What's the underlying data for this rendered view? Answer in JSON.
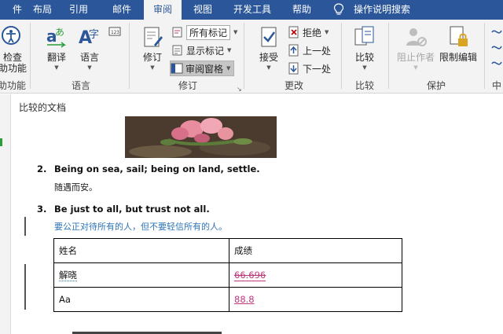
{
  "tabs": [
    {
      "label": "布局",
      "active": false
    },
    {
      "label": "引用",
      "active": false
    },
    {
      "label": "邮件",
      "active": false
    },
    {
      "label": "审阅",
      "active": true
    },
    {
      "label": "视图",
      "active": false
    },
    {
      "label": "开发工具",
      "active": false
    },
    {
      "label": "帮助",
      "active": false
    }
  ],
  "tell_me": "操作说明搜索",
  "ribbon": {
    "check_accessibility": {
      "line1": "检查",
      "line2": "助功能"
    },
    "group_accessibility": "助功能",
    "translate": "翻译",
    "language": "语言",
    "group_language": "语言",
    "track_changes": "修订",
    "markup_select": "所有标记",
    "show_markup": "显示标记",
    "reviewing_pane": "审阅窗格",
    "group_tracking": "修订",
    "accept": "接受",
    "reject": "拒绝",
    "previous": "上一处",
    "next": "下一处",
    "group_changes": "更改",
    "compare": "比较",
    "group_compare": "比较",
    "block_authors": "阻止作者",
    "restrict_editing": "限制编辑",
    "group_protect": "保护",
    "group_ink_partial": "中"
  },
  "document": {
    "title": "比较的文档",
    "items": [
      {
        "number": "2.",
        "en": "Being on sea, sail; being on land, settle.",
        "zh": "随遇而安。"
      },
      {
        "number": "3.",
        "en": "Be just to all, but trust not all.",
        "zh": "要公正对待所有的人，但不要轻信所有的人。"
      }
    ],
    "table": {
      "headers": [
        "姓名",
        "成绩"
      ],
      "rows": [
        {
          "name": "解晓",
          "score": "66.696"
        },
        {
          "name": "Aa",
          "score": "88.8"
        }
      ]
    }
  },
  "colors": {
    "brand": "#2b579a",
    "revision": "#c0397b",
    "insert_blue": "#2e75b6"
  }
}
